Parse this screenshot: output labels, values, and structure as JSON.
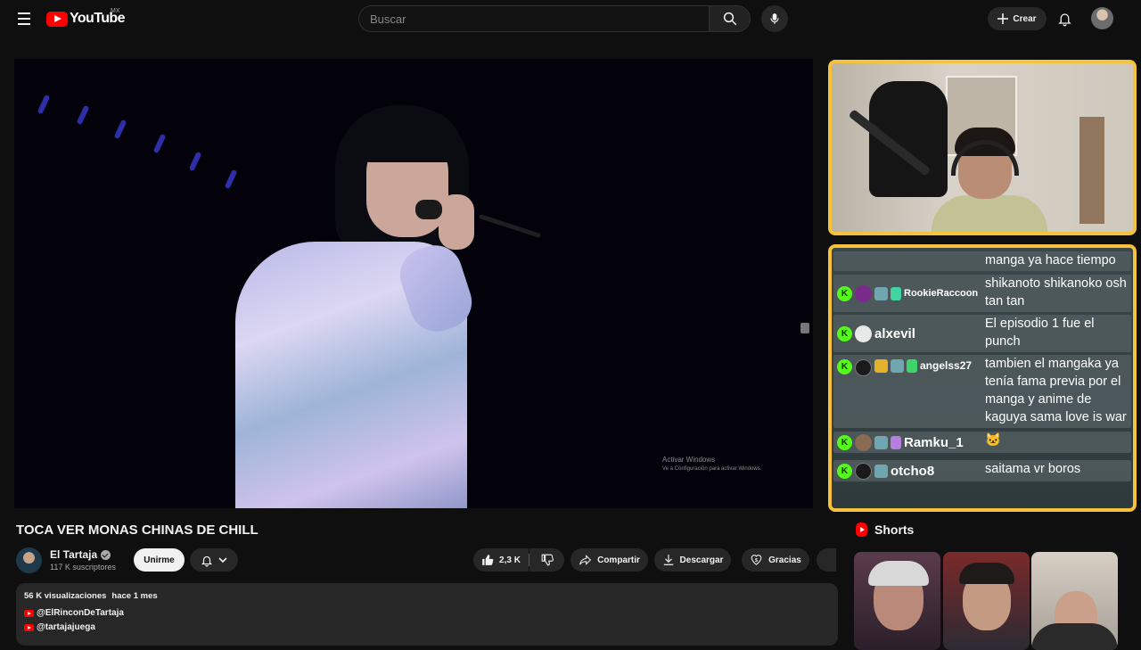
{
  "header": {
    "logo_text": "YouTube",
    "country": "MX",
    "search_placeholder": "Buscar",
    "create_label": "Crear"
  },
  "video": {
    "title": "TOCA VER MONAS CHINAS DE CHILL",
    "watermark_line1": "Activar Windows",
    "watermark_line2": "Ve a Configuración para activar Windows."
  },
  "channel": {
    "name": "El Tartaja",
    "subscribers": "117 K suscriptores",
    "join_label": "Unirme"
  },
  "actions": {
    "likes": "2,3 K",
    "share_label": "Compartir",
    "download_label": "Descargar",
    "thanks_label": "Gracias"
  },
  "description": {
    "views": "56 K visualizaciones",
    "age": "hace 1 mes",
    "links": [
      "@ElRinconDeTartaja",
      "@tartajajuega"
    ]
  },
  "chat": {
    "messages": [
      {
        "user": "",
        "text": "manga ya hace tiempo"
      },
      {
        "user": "RookieRaccoon",
        "text": "shikanoto shikanoko osh tan tan"
      },
      {
        "user": "alxevil",
        "text": "El episodio 1 fue el punch"
      },
      {
        "user": "angelss27",
        "text": "tambien el mangaka ya tenía fama previa por el manga y anime de kaguya sama love is war"
      },
      {
        "user": "Ramku_1",
        "text": "🐱"
      },
      {
        "user": "otcho8",
        "text": "saitama vr boros"
      }
    ],
    "kick_letter": "K"
  },
  "shorts": {
    "heading": "Shorts"
  },
  "colors": {
    "accent_red": "#ff0000",
    "frame_yellow": "#f5c23a",
    "kick_green": "#53fc18"
  }
}
